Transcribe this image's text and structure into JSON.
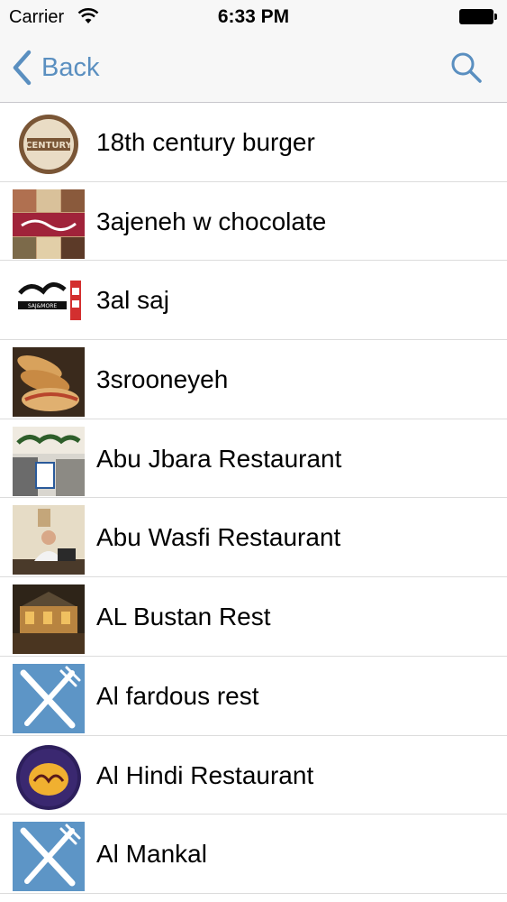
{
  "status": {
    "carrier": "Carrier",
    "time": "6:33 PM"
  },
  "nav": {
    "back_label": "Back",
    "back_icon": "chevron-left-icon",
    "search_icon": "search-icon",
    "accent_color": "#5a8fc0"
  },
  "restaurants": [
    {
      "name": "18th century burger",
      "thumb": "logo-circle-brown",
      "badge": "CENTURY"
    },
    {
      "name": "3ajeneh w chocolate",
      "thumb": "photo-collage"
    },
    {
      "name": "3al saj",
      "thumb": "logo-arabic-red",
      "badge": "SAJ&MORE"
    },
    {
      "name": "3srooneyeh",
      "thumb": "photo-sandwich"
    },
    {
      "name": "Abu Jbara Restaurant",
      "thumb": "photo-storefront"
    },
    {
      "name": "Abu Wasfi Restaurant",
      "thumb": "photo-man"
    },
    {
      "name": "AL Bustan Rest",
      "thumb": "photo-interior"
    },
    {
      "name": "Al fardous rest",
      "thumb": "placeholder-utensils"
    },
    {
      "name": "Al Hindi Restaurant",
      "thumb": "logo-circle-purple"
    },
    {
      "name": "Al Mankal",
      "thumb": "placeholder-utensils"
    }
  ]
}
